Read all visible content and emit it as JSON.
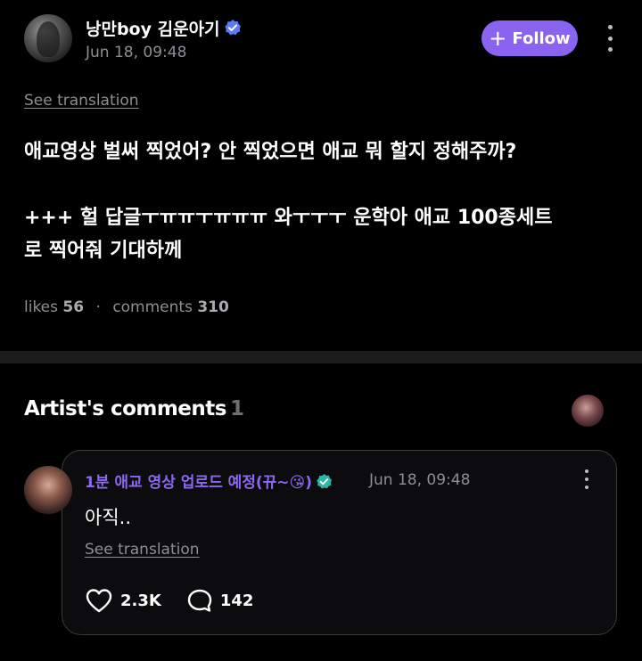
{
  "post": {
    "author_name": "낭만boy 김운아기",
    "date": "Jun 18, 09:48",
    "follow_label": "Follow",
    "see_translation": "See translation",
    "body_line1": "애교영상 벌써 찍었어? 안 찍었으면 애교 뭐 할지 정해주까?",
    "body_line2": "+++ 헐 답글ㅜㅠㅠㅜㅠㅠㅠ 와ㅜㅜㅜ 운학아 애교 100종세트",
    "body_line3": "로 찍어줘 기대하께",
    "likes_label": "likes",
    "likes_count": "56",
    "comments_label": "comments",
    "comments_count": "310"
  },
  "artist_comments": {
    "title": "Artist's comments",
    "count": "1"
  },
  "comment": {
    "author": "1분 애교 영상 업로드 예정(뀨~😘)",
    "date": "Jun 18, 09:48",
    "text": "아직..",
    "see_translation": "See translation",
    "likes": "2.3K",
    "replies": "142"
  },
  "icons": {
    "verified": "verified-badge-icon",
    "more": "more-vertical-icon",
    "heart": "heart-icon",
    "comment": "comment-bubble-icon",
    "plus": "plus-icon"
  },
  "colors": {
    "accent": "#8a63f0",
    "verified": "#5b7cf0",
    "background": "#000000",
    "muted": "#8e8e93"
  }
}
